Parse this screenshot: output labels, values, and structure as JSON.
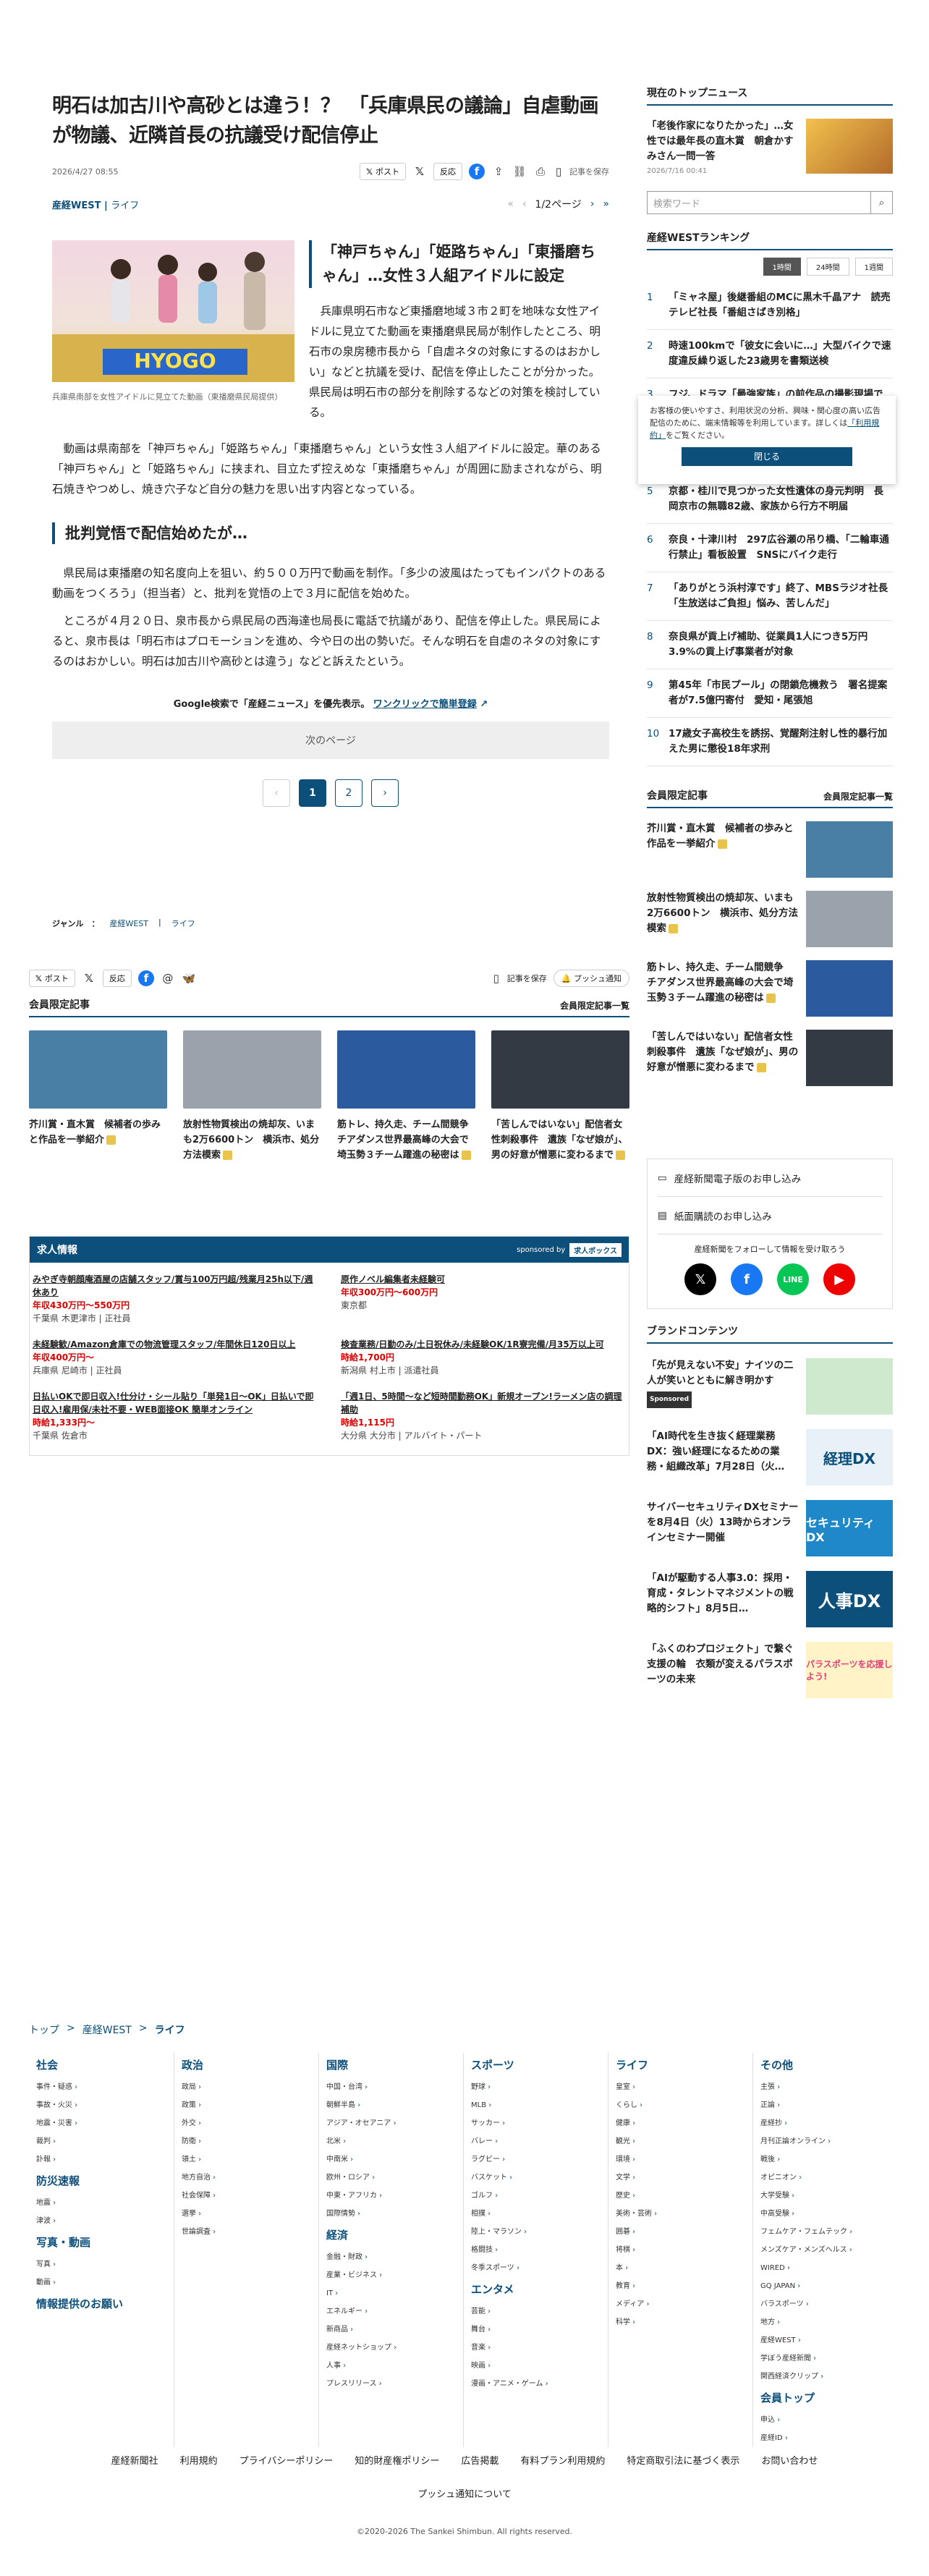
{
  "article": {
    "title": "明石は加古川や高砂とは違う！？　「兵庫県民の議論」自虐動画が物議、近隣首長の抗議受け配信停止",
    "date": "2026/4/27 08:55",
    "post_label": "ポスト",
    "reaction_label": "反応",
    "save_label": "記事を保存",
    "category": "産経WEST",
    "subcategory": "ライフ",
    "page_indicator": "1/2ページ",
    "photo_caption": "兵庫県南部を女性アイドルに見立てた動画（東播磨県民局提供）",
    "photo_text": "HYOGO",
    "subhead": "「神戸ちゃん」「姫路ちゃん」「東播磨ちゃん」…女性３人組アイドルに設定",
    "p1": "兵庫県明石市など東播磨地域３市２町を地味な女性アイドルに見立てた動画を東播磨県民局が制作したところ、明石市の泉房穂市長から「自虐ネタの対象にするのはおかしい」などと抗議を受け、配信を停止したことが分かった。県民局は明石市の部分を削除するなどの対策を検討している。",
    "p2": "動画は県南部を「神戸ちゃん」「姫路ちゃん」「東播磨ちゃん」という女性３人組アイドルに設定。華のある「神戸ちゃん」と「姫路ちゃん」に挟まれ、目立たず控えめな「東播磨ちゃん」が周囲に励まされながら、明石焼きやつめし、焼き穴子など自分の魅力を思い出す内容となっている。",
    "section": "批判覚悟で配信始めたが…",
    "p3": "県民局は東播磨の知名度向上を狙い、約５００万円で動画を制作。「多少の波風はたってもインパクトのある動画をつくろう」（担当者）と、批判を覚悟の上で３月に配信を始めた。",
    "p4": "ところが４月２０日、泉市長から県民局の西海達也局長に電話で抗議があり、配信を停止した。県民局によると、泉市長は「明石市はプロモーションを進め、今や日の出の勢いだ。そんな明石を自虐のネタの対象にするのはおかしい。明石は加古川や高砂とは違う」などと訴えたという。",
    "google_text": "Google検索で「産経ニュース」を優先表示。",
    "google_link": "ワンクリックで簡単登録",
    "next_label": "次のページ",
    "pages": [
      "1",
      "2"
    ],
    "genre_label": "ジャンル　：",
    "push_label": "プッシュ通知"
  },
  "members": {
    "heading": "会員限定記事",
    "more": "会員限定記事一覧",
    "cards": [
      {
        "title": "芥川賞・直木賞　候補者の歩みと作品を一挙紹介",
        "color": "#4a7fa5"
      },
      {
        "title": "放射性物質検出の焼却灰、いまも2万6600トン　横浜市、処分方法模索",
        "color": "#9aa3ab"
      },
      {
        "title": "筋トレ、持久走、チーム間競争　チアダンス世界最高峰の大会で埼玉勢３チーム躍進の秘密は",
        "color": "#2c5a9e"
      },
      {
        "title": "「苦しんではいない」配信者女性刺殺事件　遺族「なぜ娘が」、男の好意が憎悪に変わるまで",
        "color": "#333a44"
      }
    ]
  },
  "jobs": {
    "heading": "求人情報",
    "sponsored": "sponsored by",
    "sponsor": "求人ボックス",
    "items": [
      {
        "title": "みやぎ寺朝顔庵酒屋の店舗スタッフ/賞与100万円超/残業月25h以下/週休あり",
        "salary": "年収430万円～550万円",
        "loc": "千葉県 木更津市 | 正社員"
      },
      {
        "title": "原作ノベル編集者未経験可",
        "salary": "年収300万円～600万円",
        "loc": "東京都"
      },
      {
        "title": "未経験歓/Amazon倉庫での物流管理スタッフ/年間休日120日以上",
        "salary": "年収400万円～",
        "loc": "兵庫県 尼崎市 | 正社員"
      },
      {
        "title": "検査業務/日勤のみ/土日祝休み/未経験OK/1R寮完備/月35万以上可",
        "salary": "時給1,700円",
        "loc": "新潟県 村上市 | 派遣社員"
      },
      {
        "title": "日払いOKで即日収入!仕分け・シール貼り「単発1日～OK」日払いで即日収入!雇用保/未社不要・WEB面接OK 簡単オンライン",
        "salary": "時給1,333円～",
        "loc": "千葉県 佐倉市"
      },
      {
        "title": "「週1日、5時間～など短時間勤務OK」新規オープン!ラーメン店の調理補助",
        "salary": "時給1,115円",
        "loc": "大分県 大分市 | アルバイト・パート"
      }
    ]
  },
  "sidebar": {
    "top_heading": "現在のトップニュース",
    "top_title": "「老後作家になりたかった」…女性では最年長の直木賞　朝倉かすみさん一問一答",
    "top_date": "2026/7/16 00:41",
    "search_placeholder": "検索ワード",
    "ranking_heading": "産経WESTランキング",
    "tabs": [
      "1時間",
      "24時間",
      "1週間"
    ],
    "ranking": [
      "「ミャネ屋」後継番組のMCに黒木千晶アナ　読売テレビ社長「番組さばき別格」",
      "時速100kmで「彼女に会いに…」大型バイクで速度違反繰り返した23歳男を書類送検",
      "フジ、ドラマ「最強家族」の前作品の撮影現場で会社員ら18名暴行",
      "復帰困難？「賃貸料減」北陸新幹線の延伸ルート決定　吉村知事、新大阪の活性化目指す",
      "京都・桂川で見つかった女性遺体の身元判明　長岡京市の無職82歳、家族から行方不明届",
      "奈良・十津川村　297広谷瀬の吊り橋、「二輪車通行禁止」看板設置　SNSにバイク走行",
      "「ありがとう浜村淳です」終了、MBSラジオ社長「生放送はご負担」悩み、苦しんだ」",
      "奈良県が貢上げ補助、従業員1人につき5万円　3.9%の貢上げ事業者が対象",
      "第45年「市民プール」の閉鎖危機救う　署名提案者が7.5億円寄付　愛知・尾張旭",
      "17歳女子高校生を誘拐、覚醒剤注射し性的暴行加えた男に懲役18年求刑"
    ],
    "popup_text": "お客様の使いやすさ、利用状況の分析、興味・関心度の高い広告配信のために、端末情報等を利用しています。詳しくは",
    "popup_link": "「利用規約」",
    "popup_tail": "をご覧ください。",
    "popup_close": "閉じる",
    "members_heading": "会員限定記事",
    "members_more": "会員限定記事一覧",
    "sub_rows": [
      "産経新聞電子版のお申し込み",
      "紙面購読のお申し込み"
    ],
    "follow_text": "産経新聞をフォローして情報を受け取ろう",
    "brand_heading": "ブランドコンテンツ",
    "brand": [
      {
        "title": "「先が見えない不安」ナイツの二人が笑いとともに解き明かす",
        "sponsored": "Sponsored",
        "tag": "",
        "color": "#cfe9cf"
      },
      {
        "title": "「AI時代を生き抜く経理業務DX：強い経理になるための業務・組織改革」7月28日（火…",
        "sponsored": "",
        "tag": "経理DX",
        "color": "#e8f0f8"
      },
      {
        "title": "サイバーセキュリティDXセミナーを8月4日（火）13時からオンラインセミナー開催",
        "sponsored": "",
        "tag": "セキュリティDX",
        "color": "#1e88c8"
      },
      {
        "title": "「AIが駆動する人事3.0：採用・育成・タレントマネジメントの戦略的シフト」8月5日…",
        "sponsored": "",
        "tag": "人事DX",
        "color": "#0b4f7a"
      },
      {
        "title": "「ふくのわプロジェクト」で繋ぐ支援の輪　衣類が変えるパラスポーツの未来",
        "sponsored": "",
        "tag": "パラスポーツを応援しよう!",
        "color": "#fff3c7"
      }
    ]
  },
  "footer": {
    "breadcrumb": [
      "トップ",
      "産経WEST",
      "ライフ"
    ],
    "columns": [
      {
        "groups": [
          {
            "h": "社会",
            "items": [
              "事件・疑惑",
              "事故・火災",
              "地震・災害",
              "裁判",
              "訃報"
            ]
          },
          {
            "h": "防災速報",
            "items": [
              "地震",
              "津波"
            ]
          },
          {
            "h": "写真・動画",
            "items": [
              "写真",
              "動画"
            ]
          },
          {
            "h": "情報提供のお願い",
            "items": []
          }
        ]
      },
      {
        "groups": [
          {
            "h": "政治",
            "items": [
              "政局",
              "政策",
              "外交",
              "防衛",
              "領土",
              "地方自治",
              "社会保障",
              "選挙",
              "世論調査"
            ]
          }
        ]
      },
      {
        "groups": [
          {
            "h": "国際",
            "items": [
              "中国・台湾",
              "朝鮮半島",
              "アジア・オセアニア",
              "北米",
              "中南米",
              "欧州・ロシア",
              "中東・アフリカ",
              "国際情勢"
            ]
          },
          {
            "h": "経済",
            "items": [
              "金融・財政",
              "産業・ビジネス",
              "IT",
              "エネルギー",
              "新商品",
              "産経ネットショップ",
              "人事",
              "プレスリリース"
            ]
          }
        ]
      },
      {
        "groups": [
          {
            "h": "スポーツ",
            "items": [
              "野球",
              "MLB",
              "サッカー",
              "バレー",
              "ラグビー",
              "バスケット",
              "ゴルフ",
              "相撲",
              "陸上・マラソン",
              "格闘技",
              "冬季スポーツ"
            ]
          },
          {
            "h": "エンタメ",
            "items": [
              "芸能",
              "舞台",
              "音楽",
              "映画",
              "漫画・アニメ・ゲーム"
            ]
          }
        ]
      },
      {
        "groups": [
          {
            "h": "ライフ",
            "items": [
              "皇室",
              "くらし",
              "健康",
              "観光",
              "環境",
              "文学",
              "歴史",
              "美術・芸術",
              "囲碁",
              "将棋",
              "本",
              "教育",
              "メディア",
              "科学"
            ]
          }
        ]
      },
      {
        "groups": [
          {
            "h": "その他",
            "items": [
              "主張",
              "正論",
              "産経抄",
              "月刊正論オンライン",
              "戦後",
              "オピニオン",
              "大学受験",
              "中高受験",
              "フェムケア・フェムテック",
              "メンズケア・メンズヘルス",
              "WIRED",
              "GQ JAPAN",
              "バラスポーツ",
              "地方",
              "産経WEST",
              "学ぼう産経新聞",
              "関西経済クリップ"
            ]
          },
          {
            "h": "会員トップ",
            "items": [
              "申込",
              "産経ID"
            ]
          }
        ]
      }
    ],
    "links": [
      "産経新聞社",
      "利用規約",
      "プライバシーポリシー",
      "知的財産権ポリシー",
      "広告掲載",
      "有料プラン利用規約",
      "特定商取引法に基づく表示",
      "お問い合わせ"
    ],
    "push": "プッシュ通知について",
    "copyright": "©2020-2026 The Sankei Shimbun. All rights reserved."
  }
}
